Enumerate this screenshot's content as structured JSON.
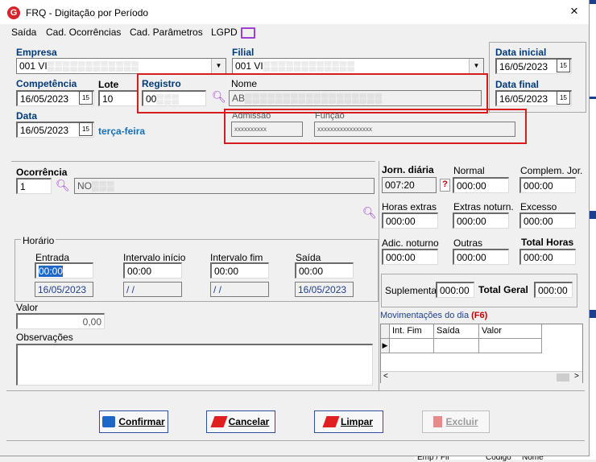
{
  "window": {
    "title": "FRQ - Digitação por Período",
    "close_icon": "×"
  },
  "menu": [
    "Saída",
    "Cad. Ocorrências",
    "Cad. Parâmetros",
    "LGPD"
  ],
  "header": {
    "empresa_label": "Empresa",
    "empresa_value": "001 VI",
    "filial_label": "Filial",
    "filial_value": "001 VI",
    "data_inicial_label": "Data inicial",
    "data_inicial_value": "16/05/2023",
    "data_final_label": "Data final",
    "data_final_value": "16/05/2023",
    "competencia_label": "Competência",
    "competencia_value": "16/05/2023",
    "lote_label": "Lote",
    "lote_value": "10",
    "registro_label": "Registro",
    "registro_value": "00",
    "nome_label": "Nome",
    "nome_value": "AB",
    "data_label": "Data",
    "data_value": "16/05/2023",
    "weekday": "terça-feira",
    "admissao_label": "Admissão",
    "admissao_value": "xxxxxxxxxx",
    "funcao_label": "Função",
    "funcao_value": "xxxxxxxxxxxxxxxxx"
  },
  "ocorrencia": {
    "label": "Ocorrência",
    "code": "1",
    "desc": "NO"
  },
  "horario": {
    "group_label": "Horário",
    "entrada_label": "Entrada",
    "entrada_value": "00:00",
    "entrada_date": "16/05/2023",
    "int_inicio_label": "Intervalo início",
    "int_inicio_value": "00:00",
    "int_inicio_date": "/ /",
    "int_fim_label": "Intervalo fim",
    "int_fim_value": "00:00",
    "int_fim_date": "/ /",
    "saida_label": "Saída",
    "saida_value": "00:00",
    "saida_date": "16/05/2023"
  },
  "valor": {
    "label": "Valor",
    "value": "0,00"
  },
  "observacoes": {
    "label": "Observações"
  },
  "jornada": {
    "jorn_label": "Jorn. diária",
    "jorn_value": "007:20",
    "jorn_help": "?",
    "normal_label": "Normal",
    "normal_value": "000:00",
    "complem_label": "Complem. Jor.",
    "complem_value": "000:00",
    "horas_extras_label": "Horas extras",
    "horas_extras_value": "000:00",
    "extras_noturn_label": "Extras noturn.",
    "extras_noturn_value": "000:00",
    "excesso_label": "Excesso",
    "excesso_value": "000:00",
    "adic_noturno_label": "Adic. noturno",
    "adic_noturno_value": "000:00",
    "outras_label": "Outras",
    "outras_value": "000:00",
    "total_horas_label": "Total Horas",
    "total_horas_value": "000:00",
    "suplementar_label": "Suplementar",
    "suplementar_value": "000:00",
    "total_geral_label": "Total Geral",
    "total_geral_value": "000:00"
  },
  "movimentacoes": {
    "label": "Movimentações do dia",
    "shortcut": "(F6)",
    "columns": [
      "Int. Fim",
      "Saída",
      "Valor"
    ]
  },
  "buttons": {
    "confirmar": "Confirmar",
    "cancelar": "Cancelar",
    "limpar": "Limpar",
    "excluir": "Excluir"
  },
  "background": {
    "col1": "Emp / Fil",
    "col2": "Código",
    "col3": "Nome"
  },
  "colors": {
    "accent": "#003a7a",
    "highlight": "#d61d1d",
    "search_icon": "#a040d0"
  }
}
